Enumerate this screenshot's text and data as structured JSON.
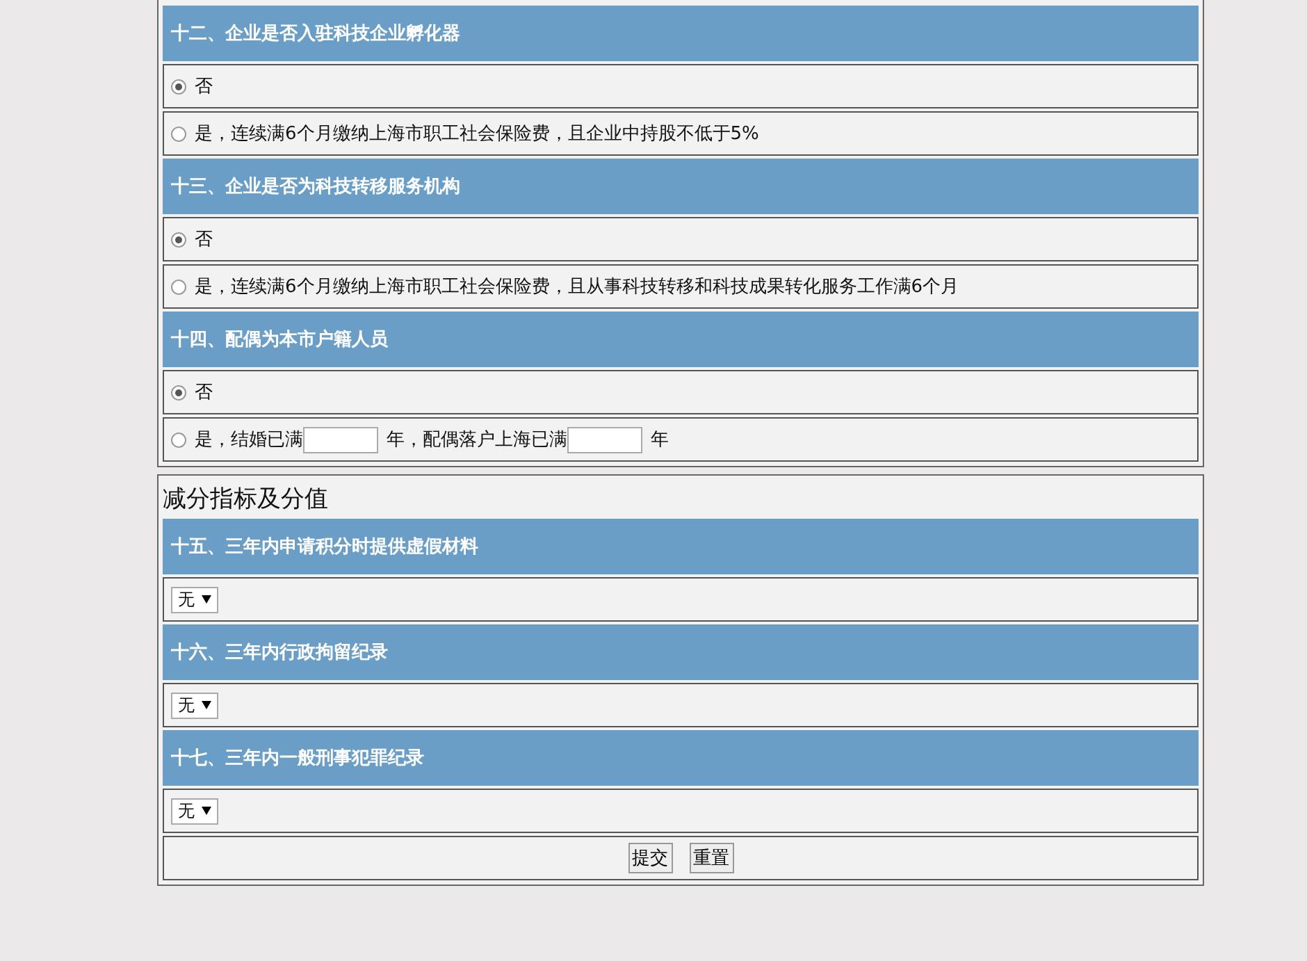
{
  "sections": [
    {
      "questions": [
        {
          "title": "十二、企业是否入驻科技企业孵化器",
          "kind": "radio",
          "options": [
            {
              "selected": true,
              "parts": [
                {
                  "kind": "text",
                  "text": "否"
                }
              ]
            },
            {
              "selected": false,
              "parts": [
                {
                  "kind": "text",
                  "text": "是，连续满6个月缴纳上海市职工社会保险费，且企业中持股不低于5%"
                }
              ]
            }
          ]
        },
        {
          "title": "十三、企业是否为科技转移服务机构",
          "kind": "radio",
          "options": [
            {
              "selected": true,
              "parts": [
                {
                  "kind": "text",
                  "text": "否"
                }
              ]
            },
            {
              "selected": false,
              "parts": [
                {
                  "kind": "text",
                  "text": "是，连续满6个月缴纳上海市职工社会保险费，且从事科技转移和科技成果转化服务工作满6个月"
                }
              ]
            }
          ]
        },
        {
          "title": "十四、配偶为本市户籍人员",
          "kind": "radio",
          "options": [
            {
              "selected": true,
              "parts": [
                {
                  "kind": "text",
                  "text": "否"
                }
              ]
            },
            {
              "selected": false,
              "parts": [
                {
                  "kind": "text",
                  "text": "是，结婚已满"
                },
                {
                  "kind": "input"
                },
                {
                  "kind": "text",
                  "text": "年，配偶落户上海已满"
                },
                {
                  "kind": "input"
                },
                {
                  "kind": "text",
                  "text": "年"
                }
              ]
            }
          ]
        }
      ]
    },
    {
      "heading": "减分指标及分值",
      "questions": [
        {
          "title": "十五、三年内申请积分时提供虚假材料",
          "kind": "select",
          "value": "无"
        },
        {
          "title": "十六、三年内行政拘留纪录",
          "kind": "select",
          "value": "无"
        },
        {
          "title": "十七、三年内一般刑事犯罪纪录",
          "kind": "select",
          "value": "无"
        }
      ],
      "buttons": [
        "提交",
        "重置"
      ]
    }
  ]
}
